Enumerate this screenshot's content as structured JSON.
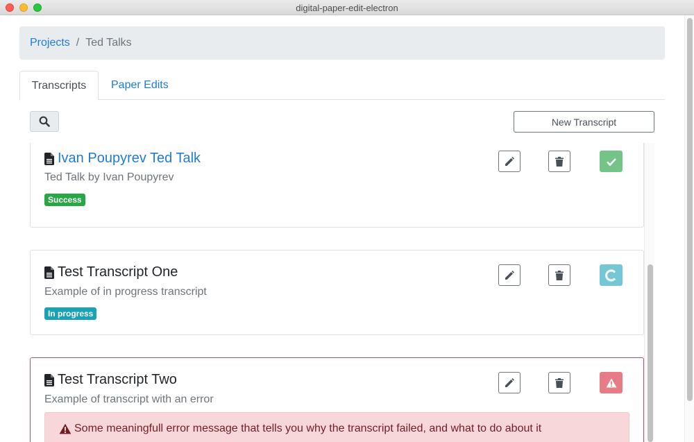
{
  "window": {
    "title": "digital-paper-edit-electron"
  },
  "breadcrumb": {
    "items": [
      "Projects",
      "Ted Talks"
    ],
    "separator": "/"
  },
  "tabs": [
    {
      "label": "Transcripts",
      "active": true
    },
    {
      "label": "Paper Edits",
      "active": false
    }
  ],
  "toolbar": {
    "search_icon": "search-icon",
    "new_label": "New Transcript"
  },
  "transcripts": [
    {
      "title": "Ivan Poupyrev Ted Talk",
      "description": "Ted Talk by Ivan Poupyrev",
      "badge": "Success",
      "status": "success",
      "status_icon": "check-icon",
      "title_link": true
    },
    {
      "title": "Test Transcript One",
      "description": "Example of in progress transcript",
      "badge": "In progress",
      "status": "progress",
      "status_icon": "spinner-icon",
      "title_link": false
    },
    {
      "title": "Test Transcript Two",
      "description": "Example of transcript with an error",
      "status": "danger",
      "status_icon": "warning-icon",
      "title_link": false,
      "error_message": "Some meaningfull error message that tells you why the transcript failed, and what to do about it"
    }
  ],
  "colors": {
    "link": "#1e7bd9",
    "success": "#28a745",
    "info": "#17a2b8",
    "danger": "#e67c85",
    "alert_bg": "#f8d7da",
    "alert_text": "#721c24"
  }
}
